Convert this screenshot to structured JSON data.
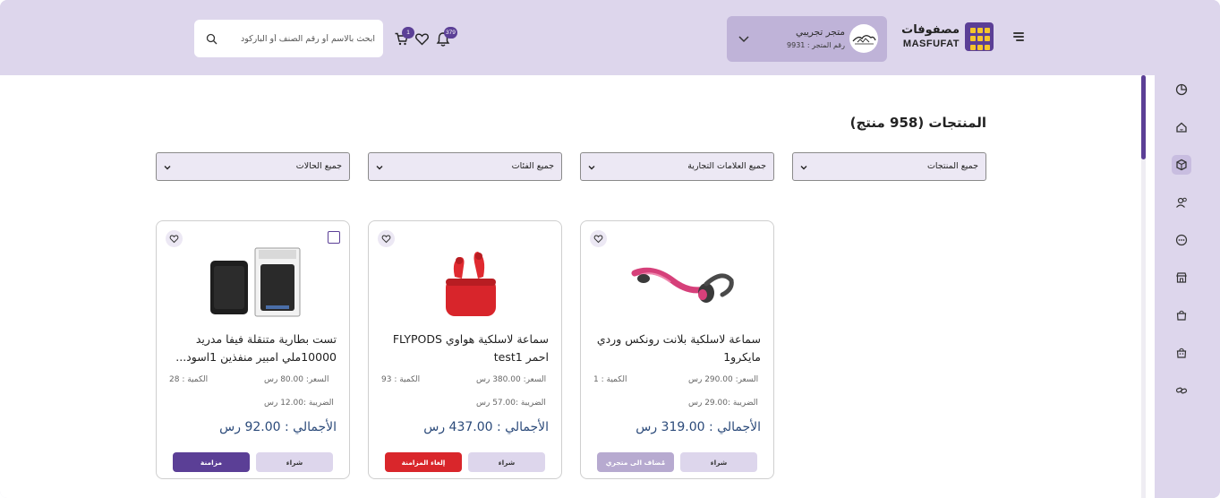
{
  "header": {
    "logo_ar": "مصفوفات",
    "logo_en": "MASFUFAT",
    "store_name": "متجر تجريبي",
    "store_number": "رقم المتجر : 9931",
    "bell_count": "379",
    "cart_count": "1",
    "search_placeholder": "ابحث بالاسم أو رقم الصنف أو الباركود"
  },
  "page": {
    "title": "المنتجات (958 منتج)"
  },
  "filters": [
    {
      "label": "جميع المنتجات"
    },
    {
      "label": "جميع العلامات التجارية"
    },
    {
      "label": "جميع الفئات"
    },
    {
      "label": "جميع الحالات"
    }
  ],
  "sidebar": {
    "items": [
      {
        "icon": "chart-pie-icon"
      },
      {
        "icon": "home-icon"
      },
      {
        "icon": "box-icon",
        "active": true
      },
      {
        "icon": "users-icon"
      },
      {
        "icon": "dots-circle-icon"
      },
      {
        "icon": "store-icon"
      },
      {
        "icon": "bag-icon"
      },
      {
        "icon": "bag-alt-icon"
      },
      {
        "icon": "link-icon"
      }
    ]
  },
  "products": [
    {
      "title": "سماعة لاسلكية بلانت رونكس وردي مايكرو1",
      "price": "السعر: 290.00 رس",
      "quantity": "الكمية : 1",
      "tax": "الضريبة :29.00 رس",
      "total": "الأجمالي : 319.00 رس",
      "buy_label": "شراء",
      "action_label": "مُضاف الى متجري",
      "action_style": "added",
      "checkbox": false
    },
    {
      "title": "سماعة لاسلكية هواوي FLYPODS احمر test1",
      "price": "السعر: 380.00 رس",
      "quantity": "الكمية : 93",
      "tax": "الضريبة :57.00 رس",
      "total": "الأجمالي : 437.00 رس",
      "buy_label": "شراء",
      "action_label": "إلغاء المزامنة",
      "action_style": "cancel",
      "checkbox": false
    },
    {
      "title": "تست بطارية متنقلة فيفا مدريد 10000ملي امبير منفذين 1اسود...",
      "price": "السعر: 80.00 رس",
      "quantity": "الكمية : 28",
      "tax": "الضريبة :12.00 رس",
      "total": "الأجمالي : 92.00 رس",
      "buy_label": "شراء",
      "action_label": "مزامنة",
      "action_style": "sync",
      "checkbox": true
    }
  ],
  "colors": {
    "accent": "#5b3f96",
    "header_bg": "#ddd6ec",
    "danger": "#d9262b",
    "total_text": "#2b4a7a"
  }
}
